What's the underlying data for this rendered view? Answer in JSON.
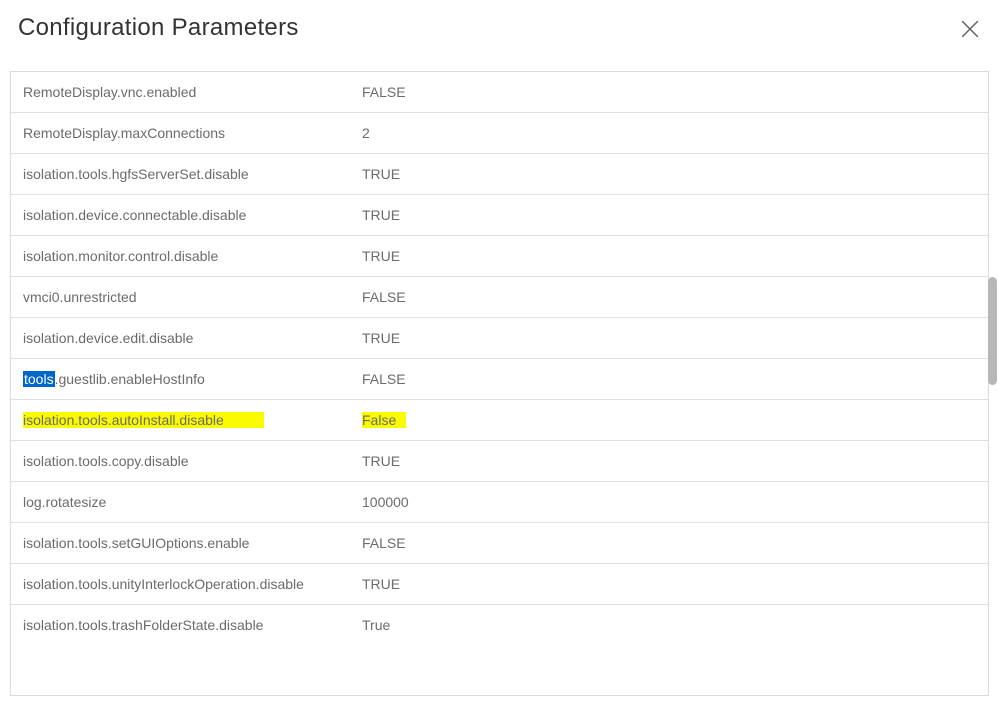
{
  "dialog": {
    "title": "Configuration Parameters"
  },
  "selectedText": "tools",
  "params": [
    {
      "name": "RemoteDisplay.vnc.enabled",
      "value": "FALSE",
      "highlighted": false,
      "hasSelection": false
    },
    {
      "name": "RemoteDisplay.maxConnections",
      "value": "2",
      "highlighted": false,
      "hasSelection": false
    },
    {
      "name": "isolation.tools.hgfsServerSet.disable",
      "value": "TRUE",
      "highlighted": false,
      "hasSelection": false
    },
    {
      "name": "isolation.device.connectable.disable",
      "value": "TRUE",
      "highlighted": false,
      "hasSelection": false
    },
    {
      "name": "isolation.monitor.control.disable",
      "value": "TRUE",
      "highlighted": false,
      "hasSelection": false
    },
    {
      "name": "vmci0.unrestricted",
      "value": "FALSE",
      "highlighted": false,
      "hasSelection": false
    },
    {
      "name": "isolation.device.edit.disable",
      "value": "TRUE",
      "highlighted": false,
      "hasSelection": false
    },
    {
      "name": ".guestlib.enableHostInfo",
      "value": "FALSE",
      "highlighted": false,
      "hasSelection": true
    },
    {
      "name": "isolation.tools.autoInstall.disable",
      "value": "False",
      "highlighted": true,
      "hasSelection": false
    },
    {
      "name": "isolation.tools.copy.disable",
      "value": "TRUE",
      "highlighted": false,
      "hasSelection": false
    },
    {
      "name": "log.rotatesize",
      "value": "100000",
      "highlighted": false,
      "hasSelection": false
    },
    {
      "name": "isolation.tools.setGUIOptions.enable",
      "value": "FALSE",
      "highlighted": false,
      "hasSelection": false
    },
    {
      "name": "isolation.tools.unityInterlockOperation.disable",
      "value": "TRUE",
      "highlighted": false,
      "hasSelection": false
    },
    {
      "name": "isolation.tools.trashFolderState.disable",
      "value": "True",
      "highlighted": false,
      "hasSelection": false
    }
  ]
}
